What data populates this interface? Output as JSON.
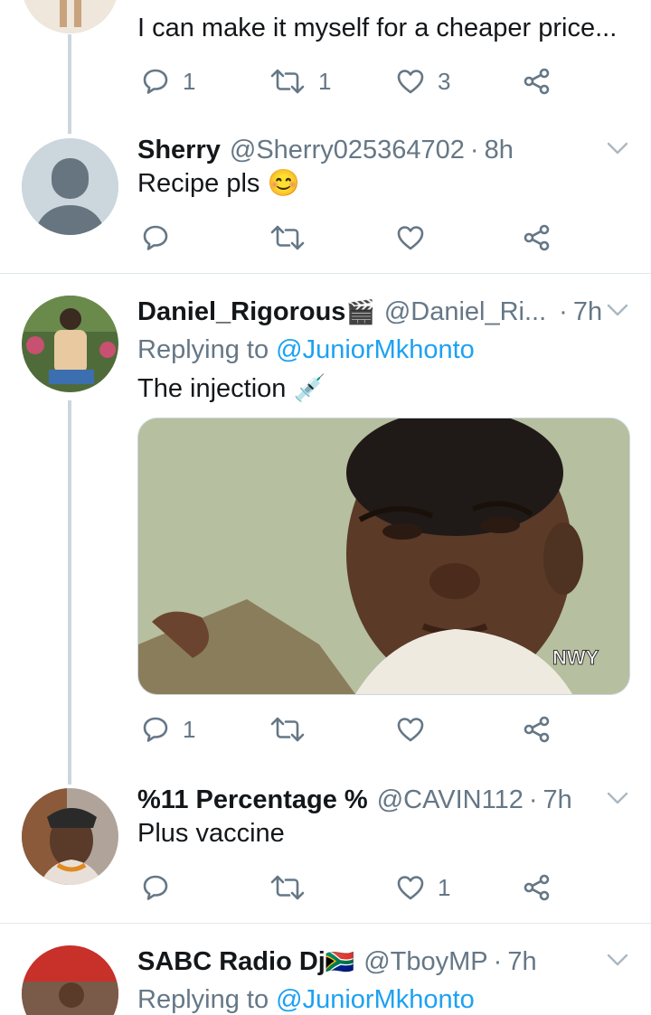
{
  "tweets": [
    {
      "text": "I can make it myself for a cheaper price...",
      "actions": {
        "replies": "1",
        "retweets": "1",
        "likes": "3"
      }
    },
    {
      "name": "Sherry",
      "handle": "@Sherry025364702",
      "time": "8h",
      "text": "Recipe  pls",
      "emoji": "😊",
      "actions": {
        "replies": "",
        "retweets": "",
        "likes": ""
      }
    },
    {
      "name": "Daniel_Rigorous",
      "name_emoji": "🎬",
      "handle": "@Daniel_Ri...",
      "time": "7h",
      "replying_prefix": "Replying to",
      "replying_to": "@JuniorMkhonto",
      "text": "The injection",
      "emoji": "💉",
      "media_watermark": "NWY",
      "actions": {
        "replies": "1",
        "retweets": "",
        "likes": ""
      }
    },
    {
      "name": "%11 Percentage %",
      "handle": "@CAVIN112",
      "time": "7h",
      "text": "Plus vaccine",
      "actions": {
        "replies": "",
        "retweets": "",
        "likes": "1"
      }
    },
    {
      "name": "SABC Radio Dj",
      "name_emoji": "🇿🇦",
      "handle": "@TboyMP",
      "time": "7h",
      "replying_prefix": "Replying to",
      "replying_to": "@JuniorMkhonto"
    }
  ],
  "separator": "·",
  "icons": [
    "reply-icon",
    "retweet-icon",
    "like-icon",
    "share-icon",
    "chevron-down-icon"
  ],
  "colors": {
    "text": "#14171a",
    "secondary": "#657786",
    "link": "#1da1f2",
    "divider": "#e1e8ed",
    "thread": "#ccd6dd"
  }
}
